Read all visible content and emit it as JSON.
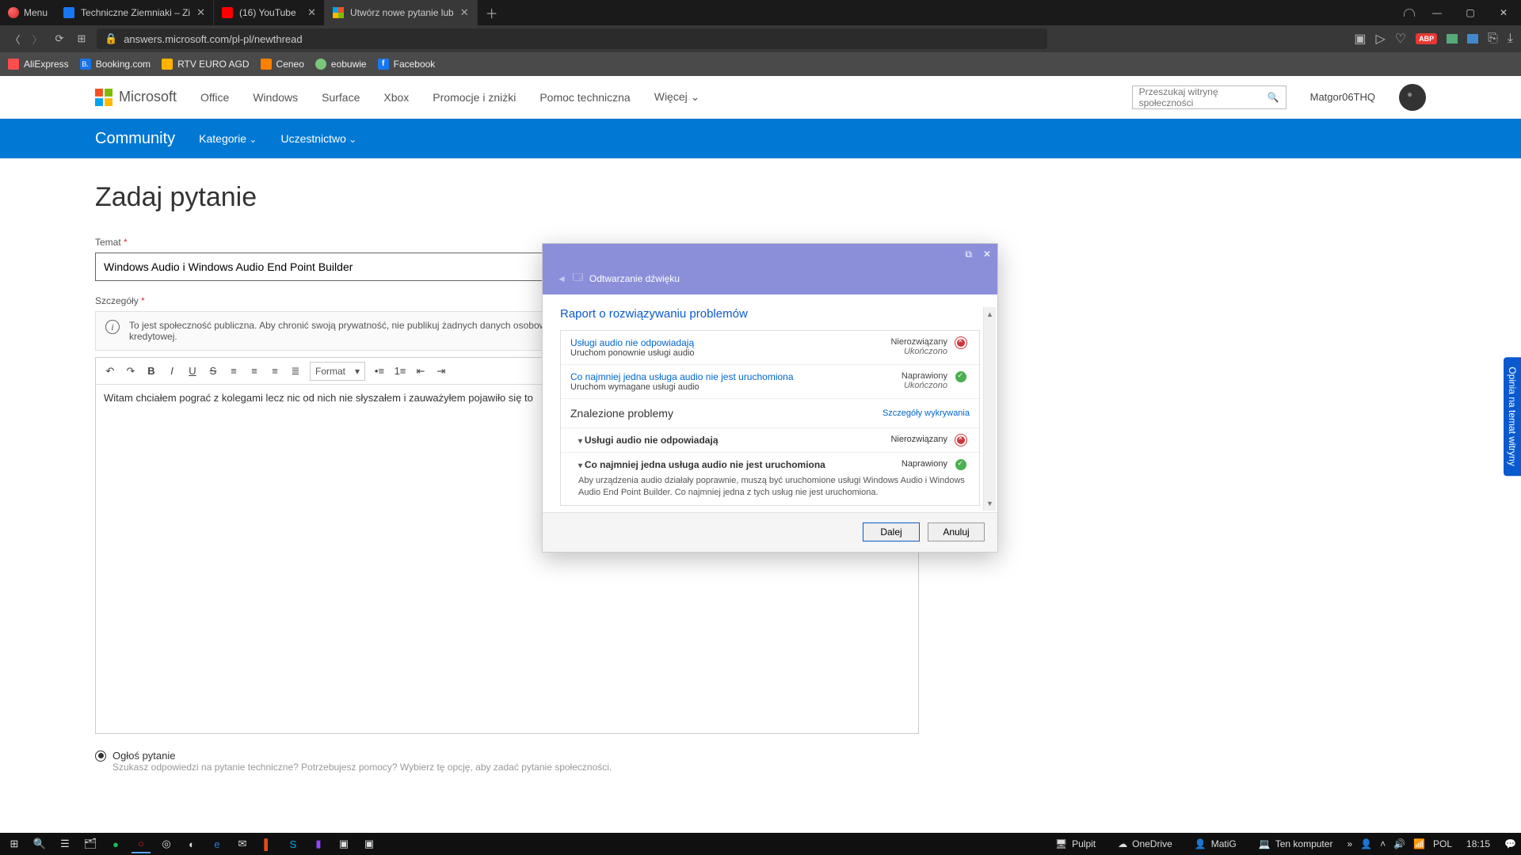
{
  "browser": {
    "menu": "Menu",
    "tabs": [
      {
        "title": "Techniczne Ziemniaki – Zi",
        "icon": "fb"
      },
      {
        "title": "(16) YouTube",
        "icon": "yt"
      },
      {
        "title": "Utwórz nowe pytanie lub",
        "icon": "ms",
        "active": true
      }
    ],
    "url": "answers.microsoft.com/pl-pl/newthread",
    "ext_badge": "ABP",
    "bookmarks": [
      {
        "label": "AliExpress",
        "color": "#ff4d4d"
      },
      {
        "label": "Booking.com",
        "color": "#1a73e8"
      },
      {
        "label": "RTV EURO AGD",
        "color": "#ffb300"
      },
      {
        "label": "Ceneo",
        "color": "#ff8000"
      },
      {
        "label": "eobuwie",
        "color": "#7bc67b"
      },
      {
        "label": "Facebook",
        "color": "#1877f2"
      }
    ]
  },
  "ms": {
    "brand": "Microsoft",
    "nav": [
      "Office",
      "Windows",
      "Surface",
      "Xbox",
      "Promocje i zniżki",
      "Pomoc techniczna",
      "Więcej"
    ],
    "search_placeholder": "Przeszukaj witrynę społeczności",
    "user": "Matgor06THQ",
    "bluebar_brand": "Community",
    "bluebar_items": [
      "Kategorie",
      "Uczestnictwo"
    ],
    "feedback": "Opinia na temat witryny"
  },
  "form": {
    "heading": "Zadaj pytanie",
    "subject_label": "Temat",
    "subject_value": "Windows Audio i Windows Audio End Point Builder",
    "details_label": "Szczegóły",
    "notice": "To jest społeczność publiczna. Aby chronić swoją prywatność, nie publikuj żadnych danych osobowych, takich jak adres e-mail, numer telefonu, klucz produktu, hasło czy numer karty kredytowej.",
    "format_label": "Format",
    "body": "Witam chciałem pograć z kolegami lecz nic od nich nie słyszałem i zauważyłem pojawiło się to",
    "radio_label": "Ogłoś pytanie",
    "radio_hint": "Szukasz odpowiedzi na pytanie techniczne? Potrzebujesz pomocy? Wybierz tę opcję, aby zadać pytanie społeczności."
  },
  "dialog": {
    "crumb": "Odtwarzanie dźwięku",
    "title": "Raport o rozwiązywaniu problemów",
    "issues": [
      {
        "name": "Usługi audio nie odpowiadają",
        "sub": "Uruchom ponownie usługi audio",
        "status": "Nierozwiązany",
        "done": "Ukończono",
        "ok": false
      },
      {
        "name": "Co najmniej jedna usługa audio nie jest uruchomiona",
        "sub": "Uruchom wymagane usługi audio",
        "status": "Naprawiony",
        "done": "Ukończono",
        "ok": true
      }
    ],
    "found_title": "Znalezione problemy",
    "found_link": "Szczegóły wykrywania",
    "found": [
      {
        "name": "Usługi audio nie odpowiadają",
        "status": "Nierozwiązany",
        "ok": false
      },
      {
        "name": "Co najmniej jedna usługa audio nie jest uruchomiona",
        "status": "Naprawiony",
        "ok": true,
        "desc": "Aby urządzenia audio działały poprawnie, muszą być uruchomione usługi Windows Audio i Windows Audio End Point Builder. Co najmniej jedna z tych usług nie jest uruchomiona."
      }
    ],
    "btn_next": "Dalej",
    "btn_cancel": "Anuluj"
  },
  "taskbar": {
    "desk_items": [
      {
        "label": "Pulpit",
        "icon": "🖥"
      },
      {
        "label": "OneDrive",
        "icon": "☁"
      },
      {
        "label": "MatiG",
        "icon": "👤"
      },
      {
        "label": "Ten komputer",
        "icon": "💻"
      }
    ],
    "clock": "18:15"
  }
}
